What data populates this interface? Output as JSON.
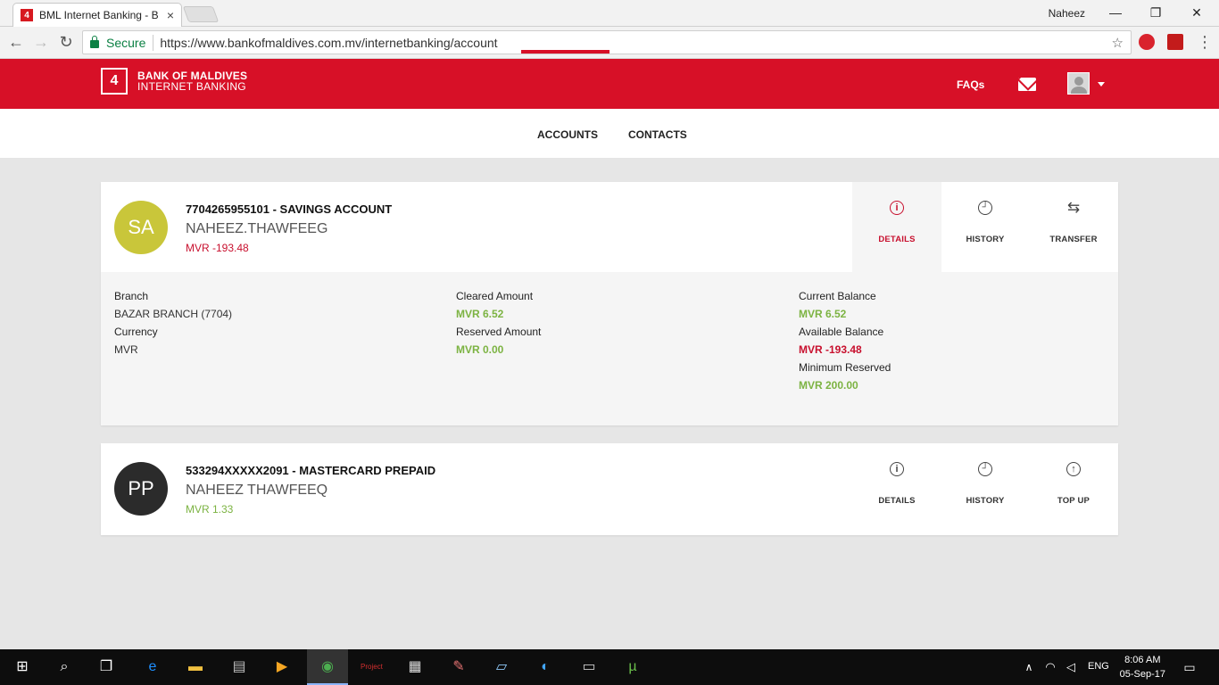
{
  "browser": {
    "tab_title": "BML Internet Banking - B",
    "tab_close": "×",
    "user_name": "Naheez",
    "secure_label": "Secure",
    "url": "https://www.bankofmaldives.com.mv/internetbanking/account",
    "win_min": "—",
    "win_restore": "❐",
    "win_close": "✕"
  },
  "header": {
    "logo_mark": "4",
    "brand_line1": "BANK OF MALDIVES",
    "brand_line2": "INTERNET BANKING",
    "faqs_label": "FAQs"
  },
  "subnav": {
    "accounts_label": "ACCOUNTS",
    "contacts_label": "CONTACTS"
  },
  "accounts": [
    {
      "initials": "SA",
      "circle_color": "#c9c63a",
      "title": "7704265955101 - SAVINGS ACCOUNT",
      "name": "NAHEEZ.THAWFEEG",
      "balance": "MVR -193.48",
      "actions": [
        "DETAILS",
        "HISTORY",
        "TRANSFER"
      ],
      "details": {
        "branch_label": "Branch",
        "branch_value": "BAZAR BRANCH (7704)",
        "currency_label": "Currency",
        "currency_value": "MVR",
        "cleared_label": "Cleared Amount",
        "cleared_value": "MVR 6.52",
        "reserved_label": "Reserved Amount",
        "reserved_value": "MVR 0.00",
        "current_label": "Current Balance",
        "current_value": "MVR 6.52",
        "available_label": "Available Balance",
        "available_value": "MVR -193.48",
        "minimum_label": "Minimum Reserved",
        "minimum_value": "MVR 200.00"
      }
    },
    {
      "initials": "PP",
      "circle_color": "#2b2b2b",
      "title": "533294XXXXX2091 - MASTERCARD PREPAID",
      "name": "NAHEEZ THAWFEEQ",
      "balance": "MVR 1.33",
      "actions": [
        "DETAILS",
        "HISTORY",
        "TOP UP"
      ]
    }
  ],
  "taskbar": {
    "time": "8:06 AM",
    "date": "05-Sep-17",
    "lang": "ENG"
  },
  "colors": {
    "brand_red": "#d71027",
    "positive_green": "#7cb342",
    "negative_red": "#c8102e"
  }
}
